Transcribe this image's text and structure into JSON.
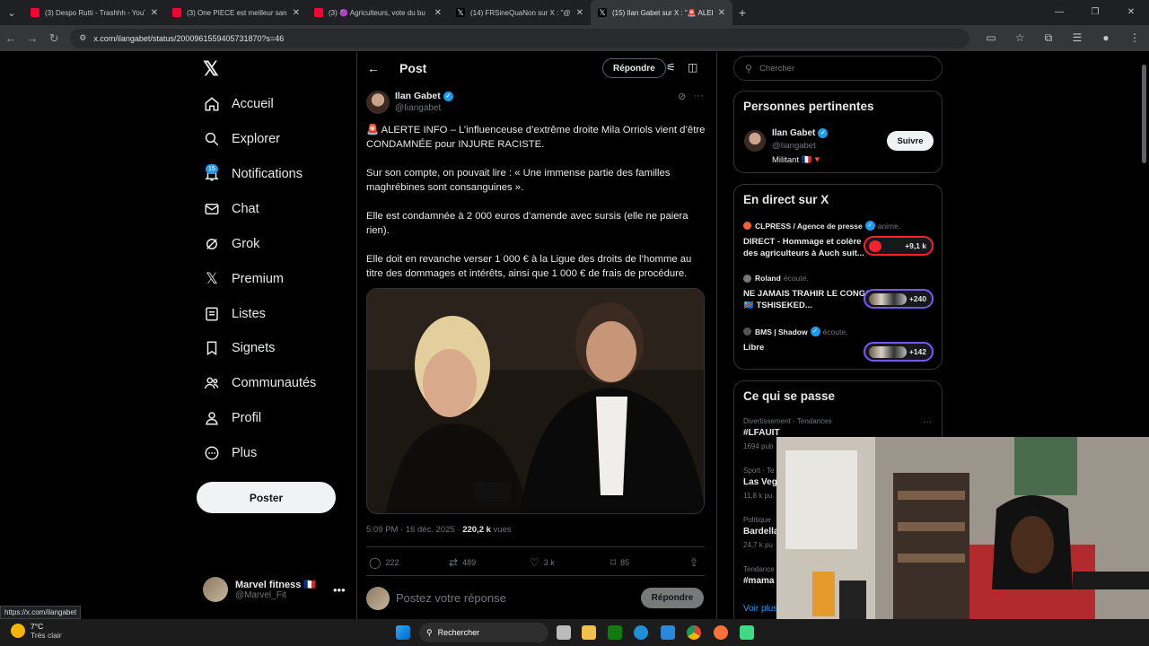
{
  "browser": {
    "tabs": [
      {
        "title": "(3) Despo Rutti - Trashhh - YouT",
        "icon": "youtube-icon"
      },
      {
        "title": "(3) One PIECE est meilleur sans",
        "icon": "youtube-icon"
      },
      {
        "title": "(3) 🟣 Agriculteurs, vote du bu",
        "icon": "youtube-icon"
      },
      {
        "title": "(14) FRSineQuaNon sur X : \"@T",
        "icon": "x-icon"
      },
      {
        "title": "(15) Ilan Gabet sur X : \"🚨 ALER",
        "icon": "x-icon",
        "active": true
      }
    ],
    "url": "x.com/ilangabet/status/2000961559405731870?s=46",
    "status_url": "https://x.com/ilangabet"
  },
  "sidebar": {
    "logo": "𝕏",
    "items": [
      {
        "label": "Accueil",
        "icon": "home-icon"
      },
      {
        "label": "Explorer",
        "icon": "search-icon"
      },
      {
        "label": "Notifications",
        "icon": "bell-icon",
        "badge": "15"
      },
      {
        "label": "Chat",
        "icon": "mail-icon"
      },
      {
        "label": "Grok",
        "icon": "grok-icon"
      },
      {
        "label": "Premium",
        "icon": "x-icon"
      },
      {
        "label": "Listes",
        "icon": "list-icon"
      },
      {
        "label": "Signets",
        "icon": "bookmark-icon"
      },
      {
        "label": "Communautés",
        "icon": "people-icon"
      },
      {
        "label": "Profil",
        "icon": "user-icon"
      },
      {
        "label": "Plus",
        "icon": "more-circle-icon"
      }
    ],
    "post_button": "Poster",
    "account": {
      "name": "Marvel fitness 🇫🇷",
      "handle": "@Marvel_Fit"
    }
  },
  "post": {
    "header_title": "Post",
    "reply_label": "Répondre",
    "author": {
      "name": "Ilan Gabet",
      "handle": "@Iiangabet"
    },
    "paragraphs": [
      "🚨 ALERTE INFO – L’influenceuse d’extrême droite Mila Orriols vient d’être CONDAMNÉE pour INJURE RACISTE.",
      "Sur son compte, on pouvait lire : « Une immense partie des familles maghrébines sont consanguines ».",
      "Elle est condamnée à 2 000 euros d’amende avec sursis (elle ne paiera rien).",
      "Elle doit en revanche verser 1 000 € à la Ligue des droits de l’homme au titre des dommages et intérêts, ainsi que 1 000 € de frais de procédure."
    ],
    "timestamp": "5:09 PM · 16 déc. 2025 · ",
    "views_count": "220,2 k",
    "views_label": " vues",
    "actions": {
      "replies": "222",
      "reposts": "489",
      "likes": "3 k",
      "bookmarks": "85"
    },
    "compose_placeholder": "Postez votre réponse",
    "compose_button": "Répondre"
  },
  "right": {
    "search_placeholder": "Chercher",
    "relevant": {
      "title": "Personnes pertinentes",
      "name": "Ilan Gabet",
      "handle": "@Iiangabet",
      "bio": "Militant 🇫🇷🔻",
      "follow": "Suivre"
    },
    "live": {
      "title": "En direct sur X",
      "items": [
        {
          "host": "CLPRESS / Agence de presse",
          "role": "anime.",
          "title": "DIRECT - Hommage et colère des agriculteurs à Auch suit...",
          "count": "+9,1 k"
        },
        {
          "host": "Roland",
          "role": "écoute.",
          "title": "NE JAMAIS TRAHIR LE CONGO 🇨🇩 TSHISEKED...",
          "count": "+240"
        },
        {
          "host": "BMS | Shadow",
          "role": "écoute.",
          "title": "Libre",
          "count": "+142"
        }
      ]
    },
    "trends": {
      "title": "Ce qui se passe",
      "items": [
        {
          "category": "Divertissement · Tendances",
          "name": "#LFAUIT",
          "count": "1694 pub"
        },
        {
          "category": "Sport · Te",
          "name": "Las Veg",
          "count": "11,8 k pu"
        },
        {
          "category": "Politique",
          "name": "Bardella",
          "count": "24,7 k pu"
        },
        {
          "category": "Tendance",
          "name": "#mama",
          "count": ""
        }
      ],
      "more": "Voir plus"
    }
  },
  "taskbar": {
    "temp": "7°C",
    "weather": "Très clair",
    "search": "Rechercher"
  }
}
